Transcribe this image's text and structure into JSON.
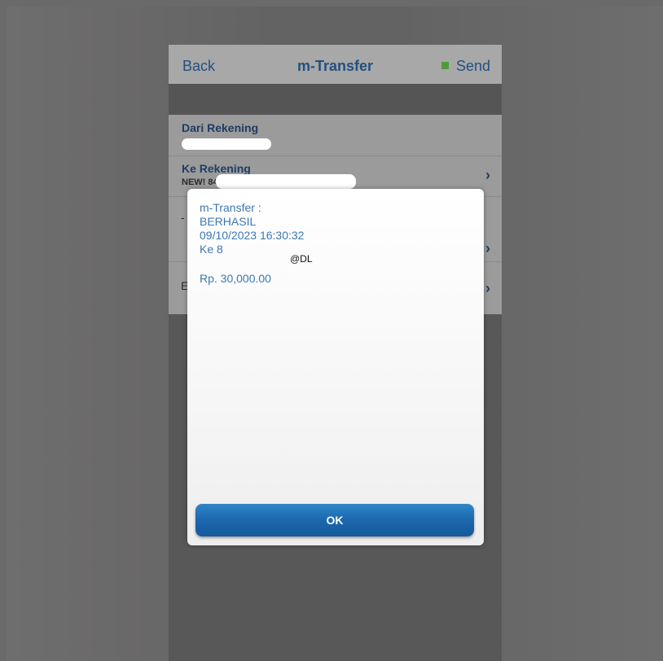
{
  "navbar": {
    "back_label": "Back",
    "title": "m-Transfer",
    "send_label": "Send"
  },
  "form": {
    "from_account_label": "Dari Rekening",
    "to_account_label": "Ke Rekening",
    "to_account_value": "NEW! 84"
  },
  "dialog": {
    "line1": "m-Transfer :",
    "line2": "BERHASIL",
    "line3": "09/10/2023 16:30:32",
    "line4": "Ke 8",
    "amount": "Rp. 30,000.00",
    "watermark": "@DL",
    "ok_label": "OK"
  },
  "colors": {
    "nav_text": "#24507e",
    "message_text": "#3a78b3",
    "ok_button": "#1c67ad",
    "send_indicator": "#4f9a3a"
  }
}
